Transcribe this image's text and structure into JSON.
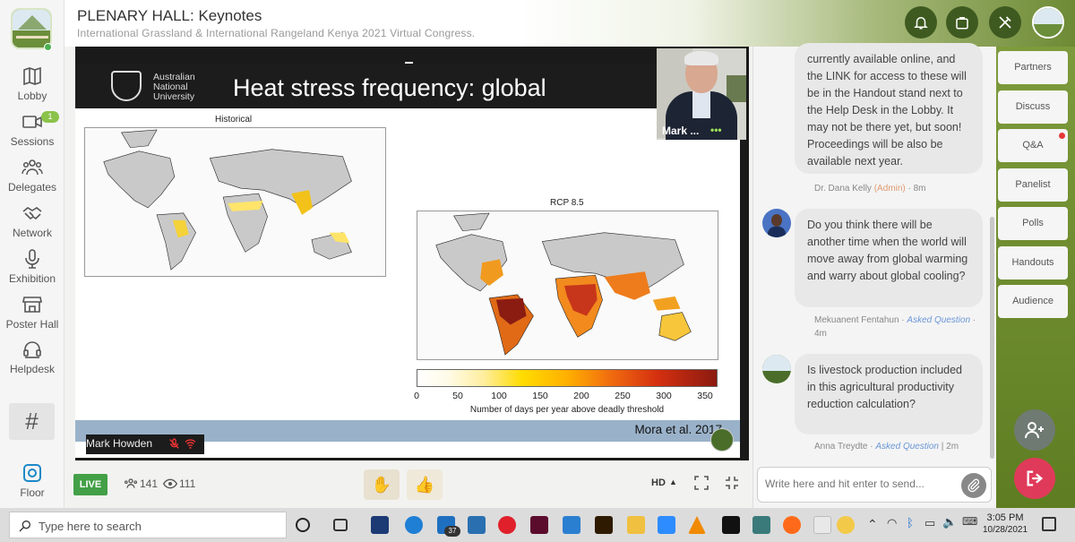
{
  "header": {
    "title": "PLENARY HALL: Keynotes",
    "subtitle": "International Grassland & International Rangeland Kenya 2021 Virtual Congress."
  },
  "nav": [
    {
      "label": "Lobby",
      "icon": "map-icon"
    },
    {
      "label": "Sessions",
      "icon": "video-icon",
      "badge": "1"
    },
    {
      "label": "Delegates",
      "icon": "people-icon"
    },
    {
      "label": "Network",
      "icon": "handshake-icon"
    },
    {
      "label": "Exhibition",
      "icon": "microphone-icon"
    },
    {
      "label": "Poster Hall",
      "icon": "store-icon"
    },
    {
      "label": "Helpdesk",
      "icon": "headset-icon"
    }
  ],
  "floor": {
    "label": "Floor",
    "icon": "floor-icon"
  },
  "hash_label": "#",
  "slide": {
    "logo_text": "Australian National University",
    "title": "Heat stress frequency: global",
    "map1_label": "Historical",
    "map2_label": "RCP 8.5",
    "colorbar_ticks": [
      "0",
      "50",
      "100",
      "150",
      "200",
      "250",
      "300",
      "350"
    ],
    "colorbar_title": "Number of days per year above deadly threshold",
    "citation": "Mora et al. 2017"
  },
  "video": {
    "speaker_name": "Mark Howden",
    "pip_name": "Mark ...",
    "pip_dots": "•••"
  },
  "controls": {
    "live_label": "LIVE",
    "attendees": "141",
    "viewers": "111",
    "hd_label": "HD",
    "raise_hand": "✋",
    "thumbs_up": "👍"
  },
  "chat": {
    "messages": [
      {
        "text": "currently available online, and the LINK for access to these will be in the Handout stand next to the Help Desk in the Lobby. It may not be there yet, but soon! Proceedings will be also be available next year.",
        "author": "Dr. Dana Kelly",
        "role": "(Admin)",
        "time": "· 8m"
      },
      {
        "text": "Do you think there will be another time when the world will move away from global warming and warry about global cooling?",
        "author": "Mekuanent Fentahun",
        "tag": "Asked Question",
        "time": "· 4m"
      },
      {
        "text": "Is livestock production included in this agricultural productivity reduction calculation?",
        "author": "Anna Treydte",
        "tag": "Asked Question",
        "time": "| 2m"
      }
    ],
    "input_placeholder": "Write here and hit enter to send..."
  },
  "right_tabs": [
    "Partners",
    "Discuss",
    "Q&A",
    "Panelist",
    "Polls",
    "Handouts",
    "Audience"
  ],
  "taskbar": {
    "search_placeholder": "Type here to search",
    "time": "3:05 PM",
    "date": "10/28/2021",
    "mail_badge": "37"
  }
}
